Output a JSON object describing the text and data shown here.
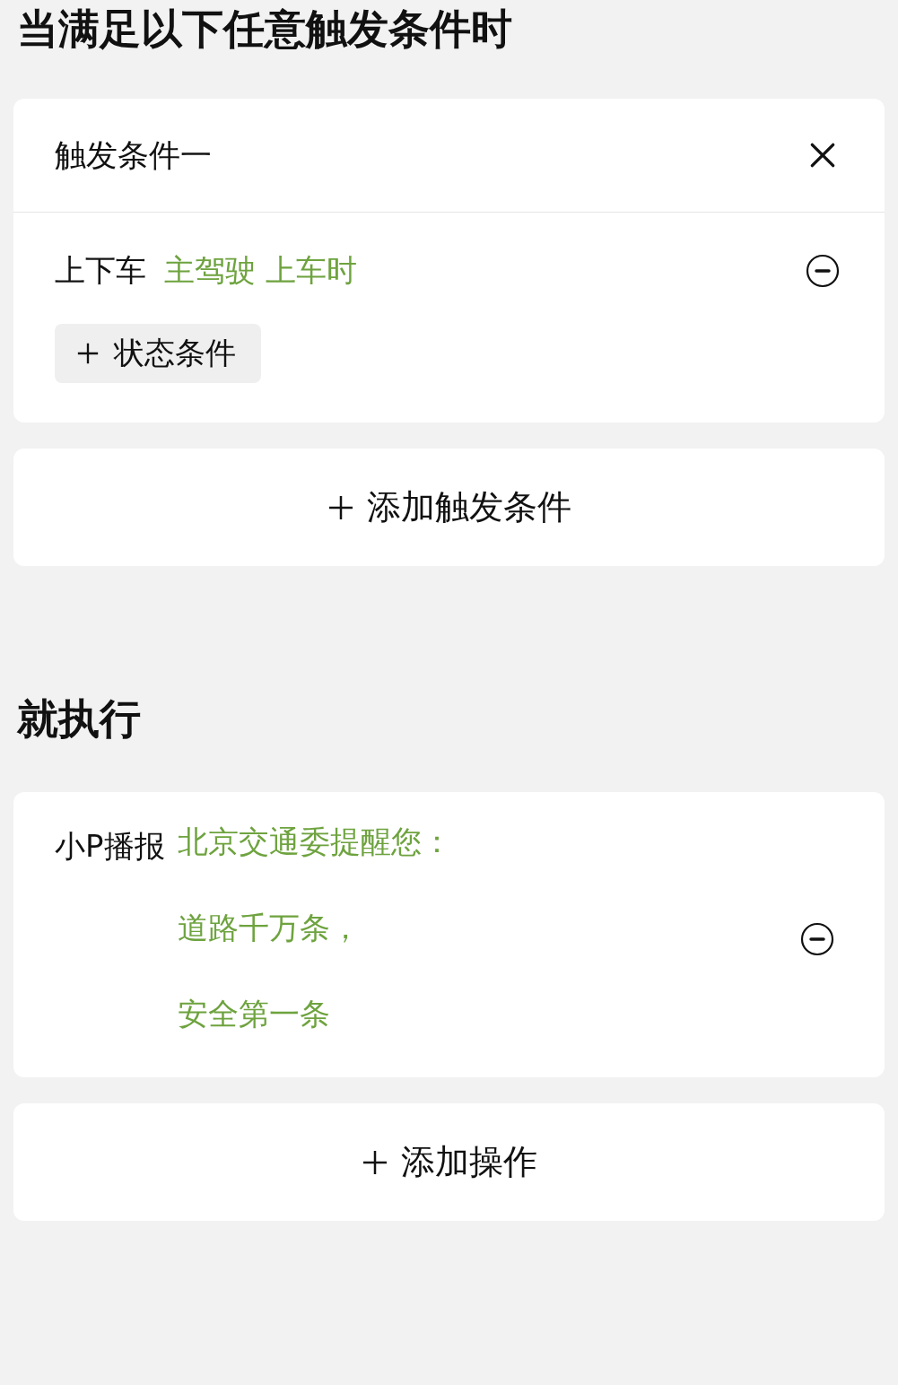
{
  "trigger_section": {
    "title": "当满足以下任意触发条件时",
    "triggers": [
      {
        "title": "触发条件一",
        "conditions": [
          {
            "label": "上下车",
            "value": "主驾驶 上车时"
          }
        ],
        "add_state_button": "状态条件"
      }
    ],
    "add_trigger_button": "添加触发条件"
  },
  "action_section": {
    "title": "就执行",
    "actions": [
      {
        "label": "小P播报",
        "lines": [
          "北京交通委提醒您：",
          "道路千万条，",
          "安全第一条"
        ]
      }
    ],
    "add_action_button": "添加操作"
  }
}
